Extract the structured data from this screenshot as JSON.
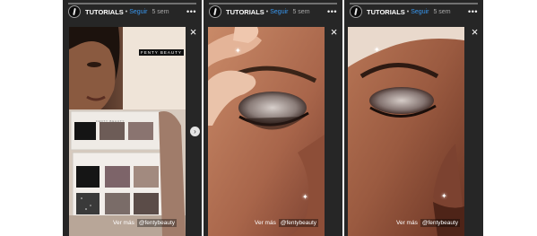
{
  "stories": [
    {
      "username": "TUTORIALS",
      "separator": "•",
      "follow_label": "Seguir",
      "time": "5 sem",
      "more_label": "•••",
      "close_label": "×",
      "see_more": "Ver más",
      "tag": "@fentybeauty",
      "watermark": "FENTY BEAUTY",
      "palette_label": "FENTY BEAUTY"
    },
    {
      "username": "TUTORIALS",
      "separator": "•",
      "follow_label": "Seguir",
      "time": "5 sem",
      "more_label": "•••",
      "close_label": "×",
      "see_more": "Ver más",
      "tag": "@fentybeauty"
    },
    {
      "username": "TUTORIALS",
      "separator": "•",
      "follow_label": "Seguir",
      "time": "5 sem",
      "more_label": "•••",
      "close_label": "×",
      "see_more": "Ver más",
      "tag": "@fentybeauty"
    }
  ],
  "next_arrow": "›",
  "sparkle": "✦",
  "colors": {
    "story_bg": "#262626",
    "follow": "#3897f0",
    "palette_case": "#e7e1db"
  }
}
